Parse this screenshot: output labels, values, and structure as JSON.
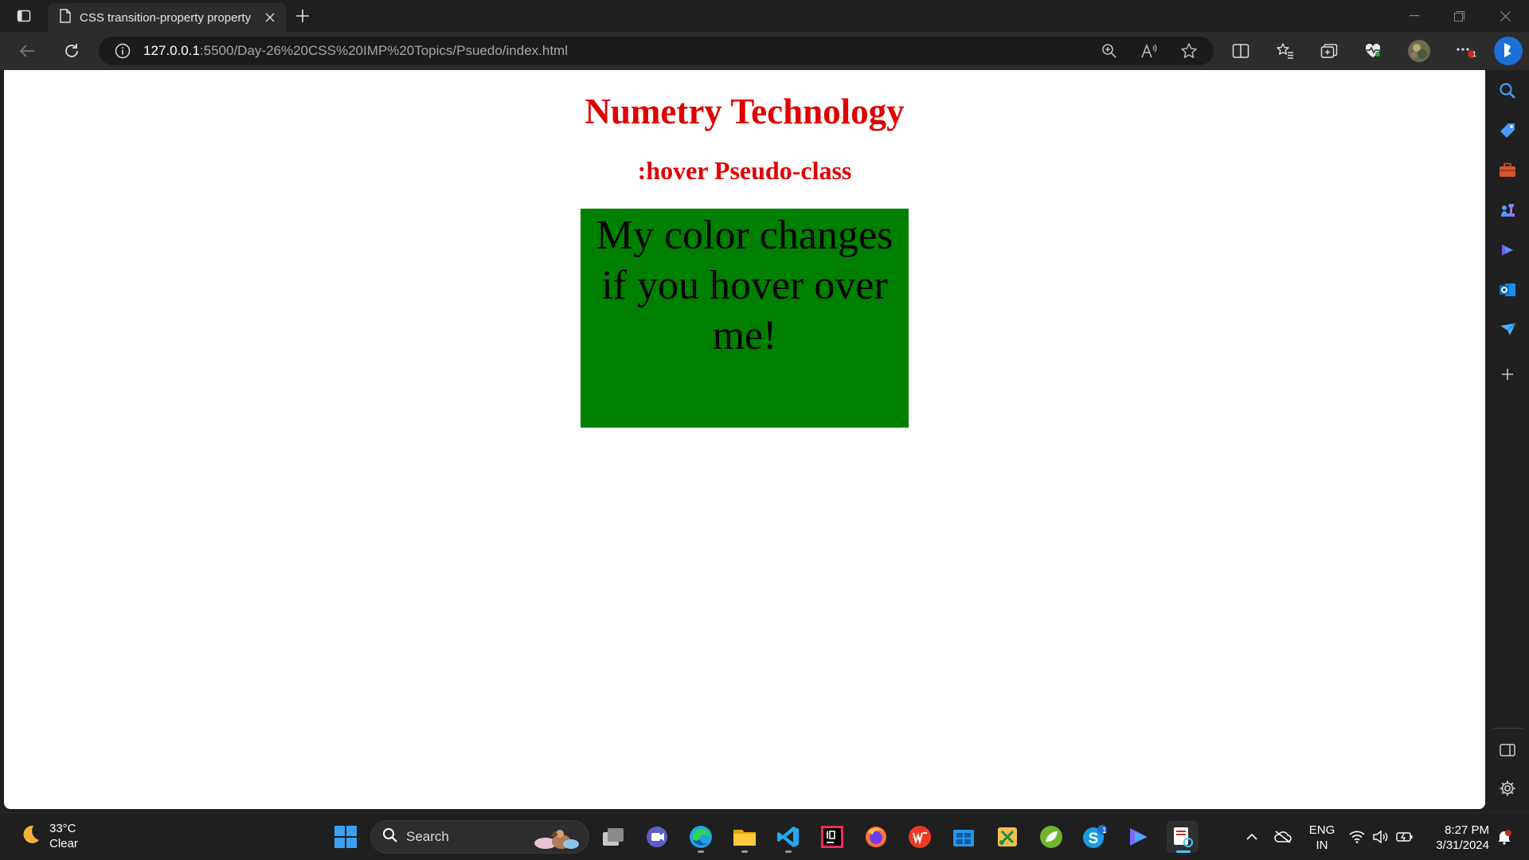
{
  "browser": {
    "tab": {
      "title": "CSS transition-property property"
    },
    "address": {
      "host": "127.0.0.1",
      "path": ":5500/Day-26%20CSS%20IMP%20Topics/Psuedo/index.html"
    },
    "profile_badge": "1"
  },
  "page": {
    "heading": "Numetry Technology",
    "subheading": ":hover Pseudo-class",
    "hover_box_text": "My color changes if you hover over me!",
    "colors": {
      "heading": "#e00000",
      "subheading": "#e00000",
      "box_bg": "#008000",
      "box_text": "#000000"
    }
  },
  "sidebar": {
    "items": [
      "search-icon",
      "tag-icon",
      "toolbox-icon",
      "chess-icon",
      "copilot-icon",
      "outlook-icon",
      "send-icon",
      "add-icon",
      "panel-icon",
      "settings-icon"
    ]
  },
  "taskbar": {
    "weather": {
      "temp": "33°C",
      "condition": "Clear"
    },
    "search_label": "Search",
    "skype_badge": "1",
    "language": {
      "line1": "ENG",
      "line2": "IN"
    },
    "clock": {
      "time": "8:27 PM",
      "date": "3/31/2024"
    }
  }
}
